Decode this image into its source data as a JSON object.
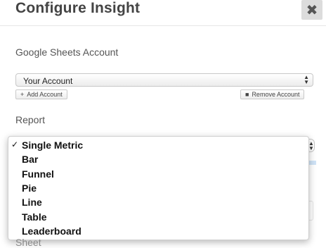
{
  "header": {
    "title": "Configure Insight",
    "close_label": "✖"
  },
  "account": {
    "label": "Google Sheets Account",
    "selected": "Your Account",
    "add_label": "Add Account",
    "remove_label": "Remove Account"
  },
  "report": {
    "label": "Report",
    "options": [
      {
        "label": "Single Metric",
        "selected": true
      },
      {
        "label": "Bar",
        "selected": false
      },
      {
        "label": "Funnel",
        "selected": false
      },
      {
        "label": "Pie",
        "selected": false
      },
      {
        "label": "Line",
        "selected": false
      },
      {
        "label": "Table",
        "selected": false
      },
      {
        "label": "Leaderboard",
        "selected": false
      }
    ],
    "check_mark": "✓"
  },
  "partial": {
    "sheet_label": "Sheet"
  }
}
